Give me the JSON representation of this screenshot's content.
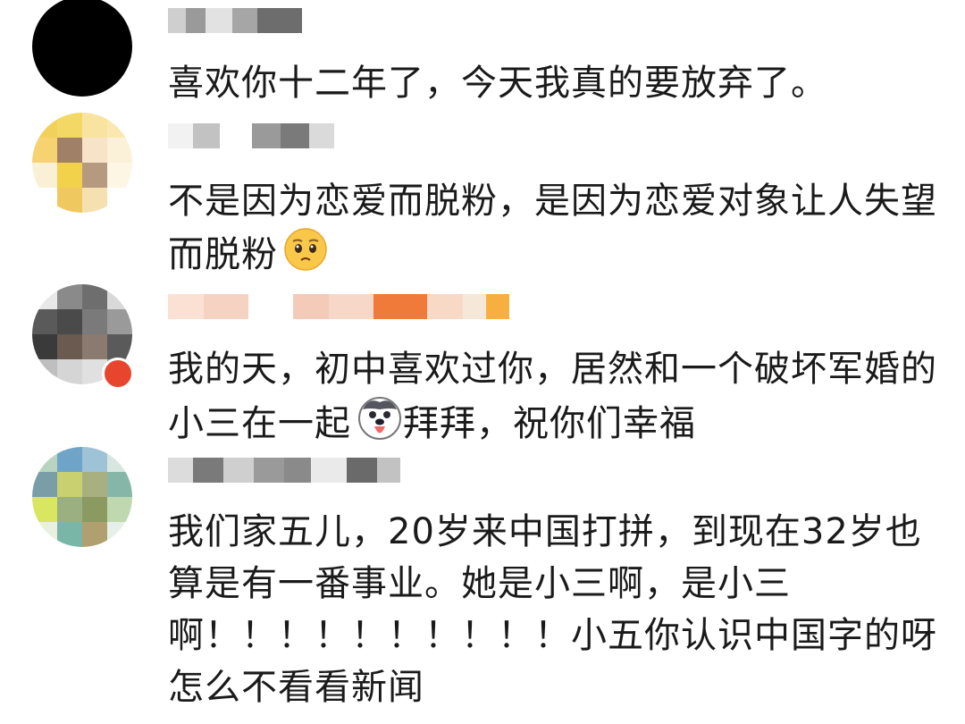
{
  "comments": [
    {
      "text": "喜欢你十二年了，今天我真的要放弃了。"
    },
    {
      "text": "不是因为恋爱而脱粉，是因为恋爱对象让人失望而脱粉",
      "emoji": "pleading-face"
    },
    {
      "text_before": "我的天，初中喜欢过你，居然和一个破坏军婚的小三在一起",
      "text_after": "拜拜，祝你们幸福",
      "emoji": "dog-tongue-face"
    },
    {
      "text": "我们家五儿，20岁来中国打拼，到现在32岁也算是有一番事业。她是小三啊，是小三啊！！！！！！！！！！小五你认识中国字的呀怎么不看看新闻"
    }
  ],
  "colors": {
    "text": "#1a1a1a",
    "badge": "#e8452f"
  }
}
